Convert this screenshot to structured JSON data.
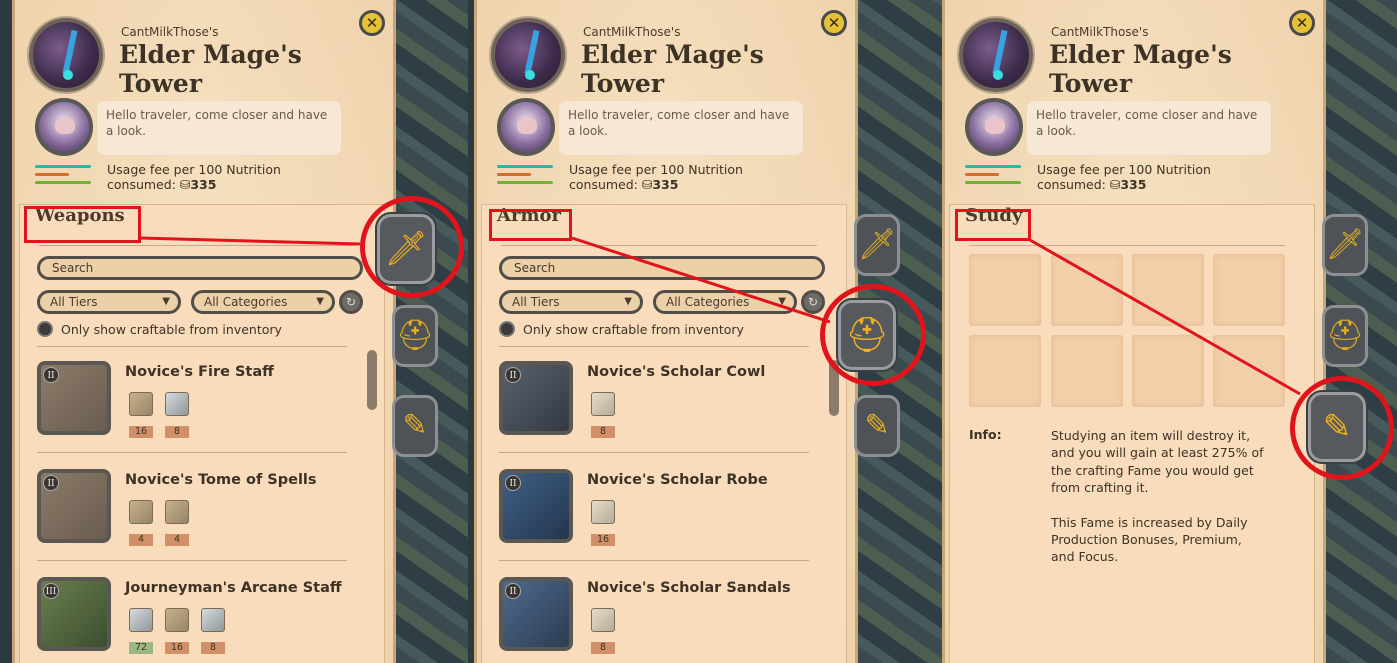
{
  "shared": {
    "owner": "CantMilkThose's",
    "building_title": "Elder Mage's Tower",
    "npc_greeting": "Hello traveler, come closer and have a look.",
    "fee_line1": "Usage fee per 100 Nutrition",
    "fee_line2": "consumed: ",
    "fee_amount": "335",
    "close_symbol": "✕",
    "search_placeholder": "Search",
    "tier_filter": "All Tiers",
    "category_filter": "All Categories",
    "craftable_toggle": "Only show craftable from inventory",
    "refresh_symbol": "↻"
  },
  "panels": [
    {
      "section_title": "Weapons",
      "items": [
        {
          "tier": "II",
          "name": "Novice's Fire Staff",
          "resources": [
            {
              "type": "wood",
              "qty": "16"
            },
            {
              "type": "metal",
              "qty": "8"
            }
          ]
        },
        {
          "tier": "II",
          "name": "Novice's Tome of Spells",
          "resources": [
            {
              "type": "wood",
              "qty": "4"
            },
            {
              "type": "leather",
              "qty": "4"
            }
          ]
        },
        {
          "tier": "III",
          "name": "Journeyman's Arcane Staff",
          "resources": [
            {
              "type": "silver",
              "qty": "72"
            },
            {
              "type": "wood",
              "qty": "16"
            },
            {
              "type": "metal",
              "qty": "8"
            }
          ]
        }
      ]
    },
    {
      "section_title": "Armor",
      "items": [
        {
          "tier": "II",
          "name": "Novice's Scholar Cowl",
          "resources": [
            {
              "type": "cloth",
              "qty": "8"
            }
          ]
        },
        {
          "tier": "II",
          "name": "Novice's Scholar Robe",
          "resources": [
            {
              "type": "cloth",
              "qty": "16"
            }
          ]
        },
        {
          "tier": "II",
          "name": "Novice's Scholar Sandals",
          "resources": [
            {
              "type": "cloth",
              "qty": "8"
            }
          ]
        }
      ]
    },
    {
      "section_title": "Study",
      "info_label": "Info:",
      "info_p1": "Studying an item will destroy it, and you will gain at least 275% of the crafting Fame you would get from crafting it.",
      "info_p2": "This Fame is increased by Daily Production Bonuses, Premium, and Focus."
    }
  ],
  "side_tabs": [
    {
      "name": "weapons",
      "icon": "sword-icon",
      "glyph": "🗡"
    },
    {
      "name": "armor",
      "icon": "helmet-icon",
      "glyph": "⛑"
    },
    {
      "name": "study",
      "icon": "study-icon",
      "glyph": "✎"
    }
  ],
  "colors": {
    "annotation_red": "#e2141b",
    "accent_gold": "#e0ac22",
    "panel_bg": "#f2d8b4"
  }
}
